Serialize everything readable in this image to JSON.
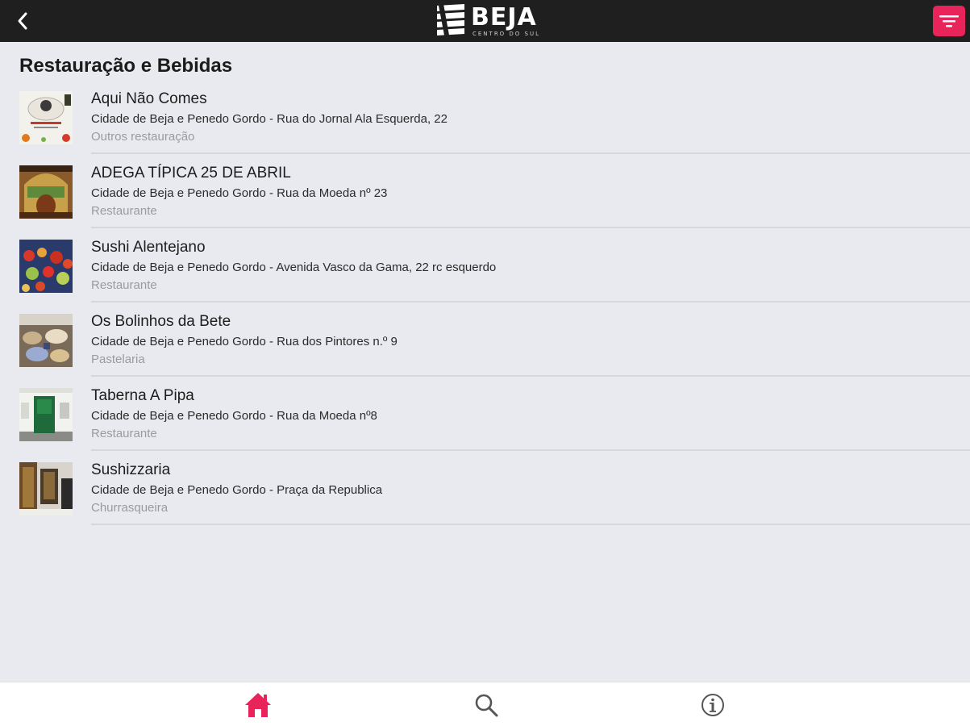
{
  "header": {
    "logo_text": "BEJA",
    "logo_subtitle": "CENTRO DO SUL",
    "back_icon": "chevron-left-icon",
    "filter_icon": "filter-icon",
    "accent_color": "#e8245a",
    "bar_color": "#1f1f1f"
  },
  "page": {
    "title": "Restauração e Bebidas"
  },
  "items": [
    {
      "name": "Aqui Não Comes",
      "address": "Cidade de Beja e Penedo Gordo - Rua do Jornal Ala Esquerda, 22",
      "category": "Outros restauração"
    },
    {
      "name": "ADEGA TÍPICA 25 DE ABRIL",
      "address": "Cidade de Beja e Penedo Gordo - Rua da Moeda nº 23",
      "category": "Restaurante"
    },
    {
      "name": "Sushi Alentejano",
      "address": "Cidade de Beja e Penedo Gordo - Avenida Vasco da Gama, 22 rc esquerdo",
      "category": "Restaurante"
    },
    {
      "name": "Os Bolinhos da Bete",
      "address": "Cidade de Beja e Penedo Gordo - Rua dos Pintores n.º 9",
      "category": "Pastelaria"
    },
    {
      "name": "Taberna A Pipa",
      "address": "Cidade de Beja e Penedo Gordo - Rua da Moeda nº8",
      "category": "Restaurante"
    },
    {
      "name": "Sushizzaria",
      "address": "Cidade de Beja e Penedo Gordo - Praça da Republica",
      "category": "Churrasqueira"
    }
  ],
  "bottom_nav": {
    "home_icon": "home-icon",
    "search_icon": "search-icon",
    "info_icon": "info-icon",
    "active_color": "#e8245a",
    "inactive_color": "#555555"
  }
}
